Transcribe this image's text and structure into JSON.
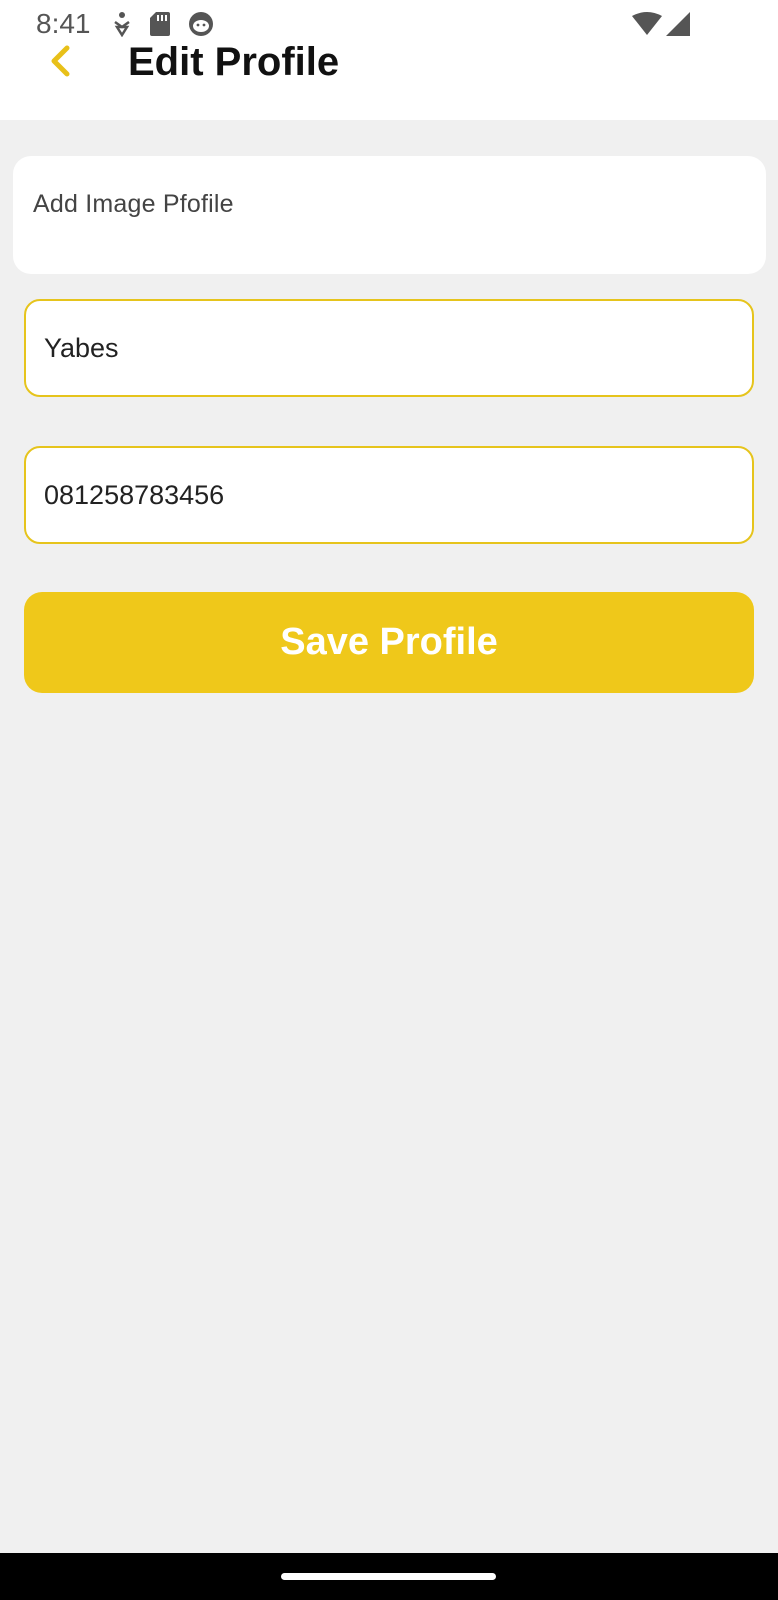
{
  "status_bar": {
    "time": "8:41",
    "icons_left": [
      "accessibility-icon",
      "sd-card-icon",
      "cat-face-icon"
    ],
    "icons_right": [
      "wifi-icon",
      "cellular-signal-icon"
    ]
  },
  "header": {
    "back_icon": "chevron-left-icon",
    "title": "Edit Profile"
  },
  "profile_image": {
    "label": "Add Image Pfofile"
  },
  "form": {
    "name_value": "Yabes",
    "phone_value": "081258783456"
  },
  "actions": {
    "save_label": "Save Profile"
  },
  "colors": {
    "accent": "#efc81a",
    "field_border": "#e6c41c",
    "background": "#f0f0f0"
  }
}
